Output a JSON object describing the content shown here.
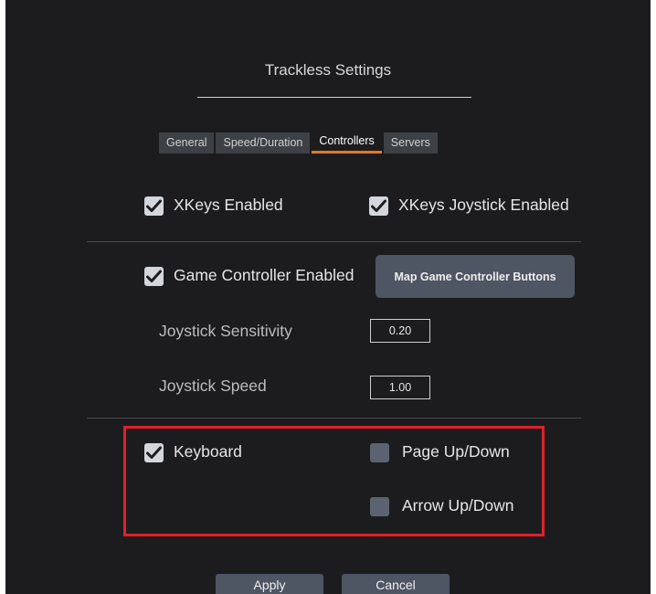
{
  "dialog": {
    "title": "Trackless Settings"
  },
  "tabs": [
    {
      "label": "General"
    },
    {
      "label": "Speed/Duration"
    },
    {
      "label": "Controllers",
      "active": true
    },
    {
      "label": "Servers"
    }
  ],
  "xkeys": {
    "enabled_label": "XKeys Enabled",
    "enabled_checked": true,
    "joystick_label": "XKeys Joystick Enabled",
    "joystick_checked": true
  },
  "game_controller": {
    "enabled_label": "Game Controller Enabled",
    "enabled_checked": true,
    "map_button_label": "Map Game Controller Buttons",
    "sensitivity_label": "Joystick Sensitivity",
    "sensitivity_value": "0.20",
    "speed_label": "Joystick Speed",
    "speed_value": "1.00"
  },
  "keyboard": {
    "keyboard_label": "Keyboard",
    "keyboard_checked": true,
    "page_label": "Page Up/Down",
    "page_checked": false,
    "arrow_label": "Arrow Up/Down",
    "arrow_checked": false
  },
  "footer": {
    "apply_label": "Apply",
    "cancel_label": "Cancel"
  },
  "colors": {
    "tab_accent": "#e5781e",
    "highlight_border": "#e0202a",
    "background": "#1c1c1e"
  }
}
